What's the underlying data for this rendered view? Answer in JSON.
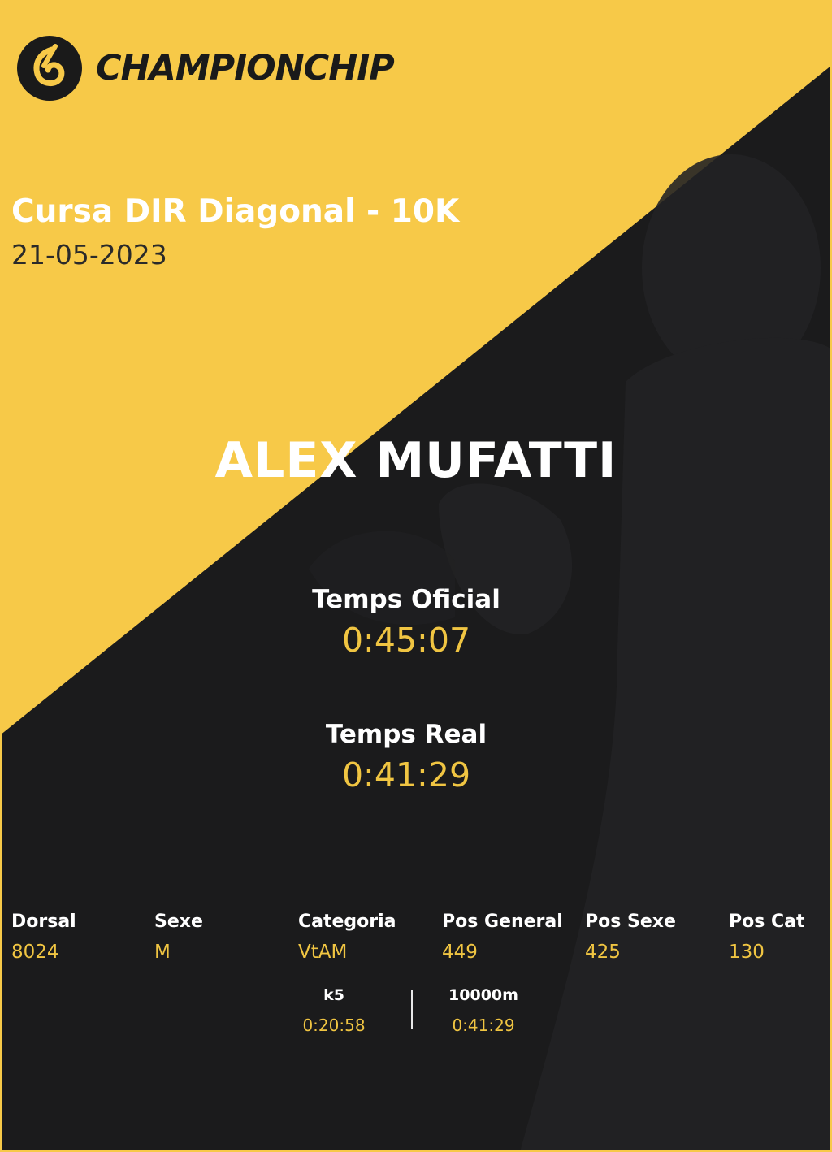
{
  "brand": {
    "name": "CHAMPIONCHIP"
  },
  "event": {
    "title": "Cursa DIR Diagonal - 10K",
    "date": "21-05-2023"
  },
  "runner": {
    "name": "ALEX MUFATTI"
  },
  "times": {
    "official": {
      "label": "Temps Oficial",
      "value": "0:45:07"
    },
    "real": {
      "label": "Temps Real",
      "value": "0:41:29"
    }
  },
  "stats": [
    {
      "label": "Dorsal",
      "value": "8024"
    },
    {
      "label": "Sexe",
      "value": "M"
    },
    {
      "label": "Categoria",
      "value": "VtAM"
    },
    {
      "label": "Pos General",
      "value": "449"
    },
    {
      "label": "Pos Sexe",
      "value": "425"
    },
    {
      "label": "Pos Cat",
      "value": "130"
    }
  ],
  "splits": [
    {
      "label": "k5",
      "value": "0:20:58"
    },
    {
      "label": "10000m",
      "value": "0:41:29"
    }
  ],
  "colors": {
    "accent": "#f7c948",
    "dark": "#1b1b1c",
    "value": "#f0c542"
  }
}
